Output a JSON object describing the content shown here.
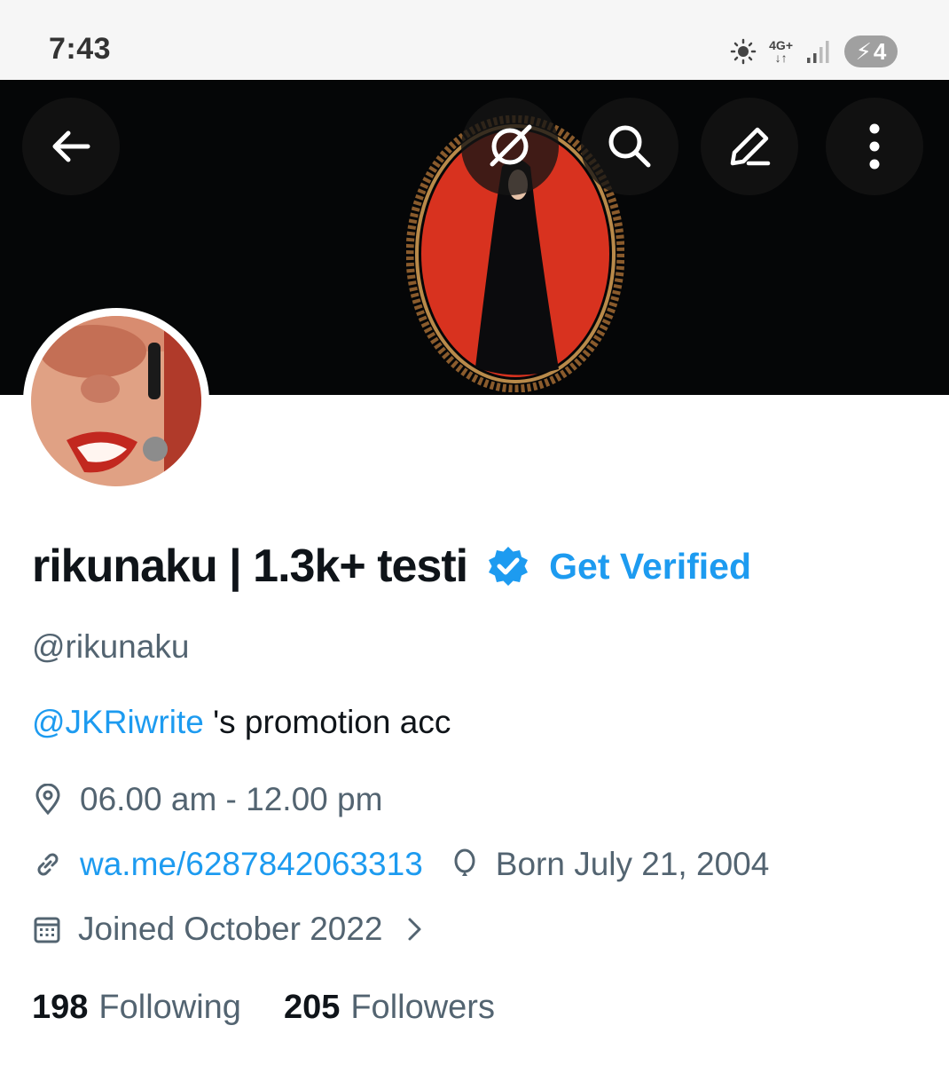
{
  "status_bar": {
    "time": "7:43",
    "network_label": "4G+",
    "battery_level": "4",
    "icons": [
      "brightness-icon",
      "network-4g-icon",
      "signal-icon",
      "battery-charging-icon"
    ]
  },
  "header": {
    "buttons": [
      "back-arrow-icon",
      "grok-icon",
      "search-icon",
      "edit-icon",
      "more-vertical-icon"
    ]
  },
  "profile": {
    "display_name": "rikunaku | 1.3k+ testi",
    "verified_badge": "verified-badge-icon",
    "get_verified_label": "Get Verified",
    "handle": "@rikunaku",
    "bio_mention": "@JKRiwrite",
    "bio_text": " 's promotion acc",
    "location": "06.00 am - 12.00 pm",
    "link": "wa.me/6287842063313",
    "birthday": "Born July 21, 2004",
    "joined": "Joined October 2022",
    "following_count": "198",
    "following_label": "Following",
    "followers_count": "205",
    "followers_label": "Followers"
  },
  "colors": {
    "accent": "#1d9bf0",
    "secondary_text": "#536471",
    "banner_background": "#050607",
    "frame_red": "#d8321f"
  }
}
